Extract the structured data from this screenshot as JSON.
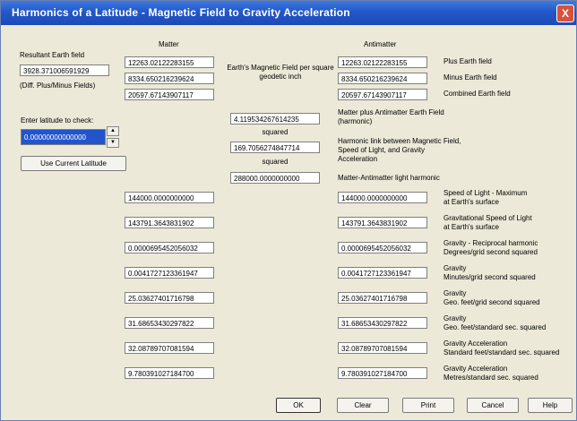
{
  "window": {
    "title": "Harmonics of a Latitude - Magnetic Field to Gravity Acceleration",
    "close": "X"
  },
  "left": {
    "resultant_label": "Resultant Earth field",
    "resultant_value": "3928.371006591929",
    "diff_label": "(Diff. Plus/Minus Fields)",
    "latitude_label": "Enter latitude to check:",
    "latitude_value": "0.00000000000000",
    "use_current_button": "Use Current Latitude",
    "spin_up": "▲",
    "spin_down": "▼"
  },
  "headers": {
    "matter": "Matter",
    "antimatter": "Antimatter"
  },
  "center": {
    "field_caption": "Earth's Magnetic Field per square geodetic inch",
    "harmonic_value": "4.119534267614235",
    "squared1": "squared",
    "link_value": "169.7056274847714",
    "squared2": "squared",
    "light_value": "288000.0000000000"
  },
  "matter_fields": [
    "12263.02122283155",
    "8334.650216239624",
    "20597.67143907117"
  ],
  "antimatter_fields": [
    "12263.02122283155",
    "8334.650216239624",
    "20597.67143907117"
  ],
  "right_labels": {
    "plus": "Plus Earth field",
    "minus": "Minus Earth field",
    "combined": "Combined Earth field",
    "harmonic": "Matter plus Antimatter Earth Field (harmonic)",
    "link": "Harmonic link between Magnetic Field, Speed of Light, and Gravity Acceleration",
    "light_harmonic": "Matter-Antimatter light harmonic"
  },
  "rows": [
    {
      "matter": "144000.0000000000",
      "antimatter": "144000.0000000000",
      "label1": "Speed of Light - Maximum",
      "label2": "at Earth's surface"
    },
    {
      "matter": "143791.3643831902",
      "antimatter": "143791.3643831902",
      "label1": "Gravitational Speed of Light",
      "label2": "at Earth's surface"
    },
    {
      "matter": "0.0000695452056032",
      "antimatter": "0.0000695452056032",
      "label1": "Gravity - Reciprocal harmonic",
      "label2": "Degrees/grid second squared"
    },
    {
      "matter": "0.0041727123361947",
      "antimatter": "0.0041727123361947",
      "label1": "Gravity",
      "label2": "Minutes/grid second squared"
    },
    {
      "matter": "25.03627401716798",
      "antimatter": "25.03627401716798",
      "label1": "Gravity",
      "label2": "Geo. feet/grid second squared"
    },
    {
      "matter": "31.68653430297822",
      "antimatter": "31.68653430297822",
      "label1": "Gravity",
      "label2": "Geo. feet/standard sec. squared"
    },
    {
      "matter": "32.08789707081594",
      "antimatter": "32.08789707081594",
      "label1": "Gravity Acceleration",
      "label2": "Standard feet/standard sec. squared"
    },
    {
      "matter": "9.780391027184700",
      "antimatter": "9.780391027184700",
      "label1": "Gravity Acceleration",
      "label2": "Metres/standard sec. squared"
    }
  ],
  "buttons": {
    "ok": "OK",
    "clear": "Clear",
    "print": "Print",
    "cancel": "Cancel",
    "help": "Help"
  }
}
